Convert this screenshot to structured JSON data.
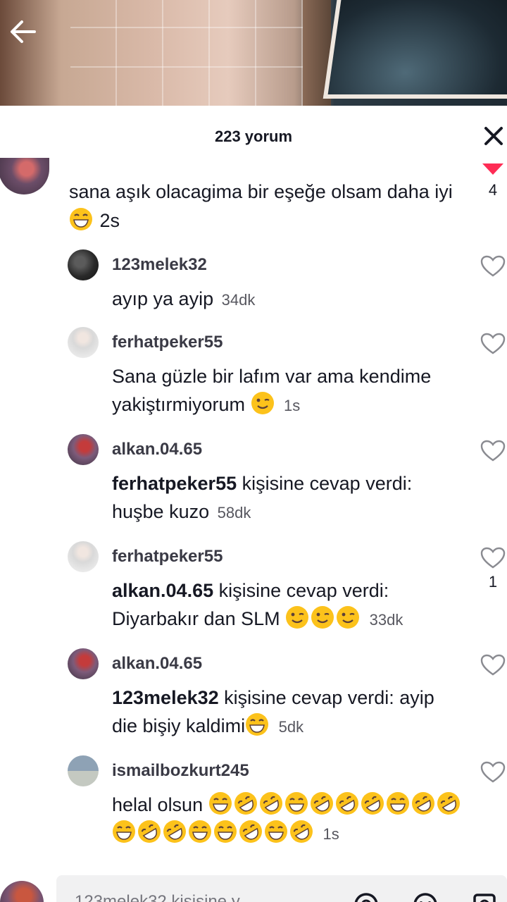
{
  "header": {
    "title": "223 yorum"
  },
  "top_comment": {
    "text": "sana aşık olacagima bir eşeğe olsam daha iyi",
    "time": "2s",
    "likes": "4"
  },
  "replies": [
    {
      "username": "123melek32",
      "reply_to": "",
      "text": "ayıp ya ayip",
      "time": "34dk",
      "likes": ""
    },
    {
      "username": "ferhatpeker55",
      "reply_to": "",
      "text": "Sana güzle bir lafım var ama kendime yakiştırmiyorum",
      "time": "1s",
      "likes": ""
    },
    {
      "username": "alkan.04.65",
      "reply_to": "ferhatpeker55",
      "reply_suffix": "kişisine cevap verdi:",
      "text": "huşbe kuzo",
      "time": "58dk",
      "likes": ""
    },
    {
      "username": "ferhatpeker55",
      "reply_to": "alkan.04.65",
      "reply_suffix": "kişisine cevap verdi:",
      "text": "Diyarbakır dan SLM",
      "time": "33dk",
      "likes": "1"
    },
    {
      "username": "alkan.04.65",
      "reply_to": "123melek32",
      "reply_suffix": "kişisine cevap verdi:",
      "text": "ayip die bişiy kaldimi",
      "time": "5dk",
      "likes": ""
    },
    {
      "username": "ismailbozkurt245",
      "reply_to": "",
      "text": "helal olsun",
      "time": "1s",
      "likes": ""
    }
  ],
  "input": {
    "placeholder": "123melek32 kişisine y"
  },
  "colors": {
    "like_active": "#fe2c55",
    "text": "#161823",
    "muted": "#57575f"
  }
}
